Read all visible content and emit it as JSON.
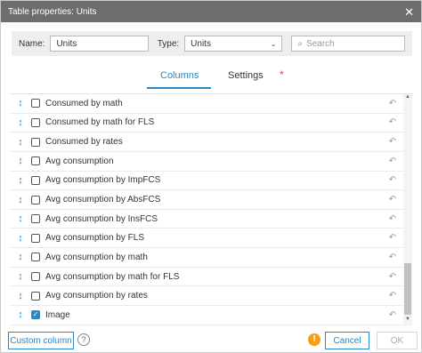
{
  "window": {
    "title": "Table properties: Units"
  },
  "filter": {
    "name_label": "Name:",
    "name_value": "Units",
    "type_label": "Type:",
    "type_value": "Units",
    "search_placeholder": "Search"
  },
  "tabs": [
    {
      "label": "Columns",
      "active": true
    },
    {
      "label": "Settings",
      "active": false
    }
  ],
  "tab_dot": "*",
  "rows": [
    {
      "label": "Consumed by math",
      "checked": false
    },
    {
      "label": "Consumed by math for FLS",
      "checked": false
    },
    {
      "label": "Consumed by rates",
      "checked": false
    },
    {
      "label": "Avg consumption",
      "checked": false
    },
    {
      "label": "Avg consumption by ImpFCS",
      "checked": false
    },
    {
      "label": "Avg consumption by AbsFCS",
      "checked": false
    },
    {
      "label": "Avg consumption by InsFCS",
      "checked": false
    },
    {
      "label": "Avg consumption by FLS",
      "checked": false
    },
    {
      "label": "Avg consumption by math",
      "checked": false
    },
    {
      "label": "Avg consumption by math for FLS",
      "checked": false
    },
    {
      "label": "Avg consumption by rates",
      "checked": false
    },
    {
      "label": "Image",
      "checked": true
    }
  ],
  "footer": {
    "custom_column_label": "Custom column",
    "help_glyph": "?",
    "warning_glyph": "!",
    "cancel_label": "Cancel",
    "ok_label": "OK"
  },
  "colors": {
    "accent": "#2b86c5",
    "titlebar": "#6d6d6d",
    "warning": "#f59c1a",
    "tab_dot": "#e53935"
  },
  "icons": {
    "close": "close-icon",
    "search": "search-icon",
    "drag": "drag-handle-icon",
    "undo": "undo-icon",
    "help": "help-icon",
    "warning": "warning-icon"
  }
}
